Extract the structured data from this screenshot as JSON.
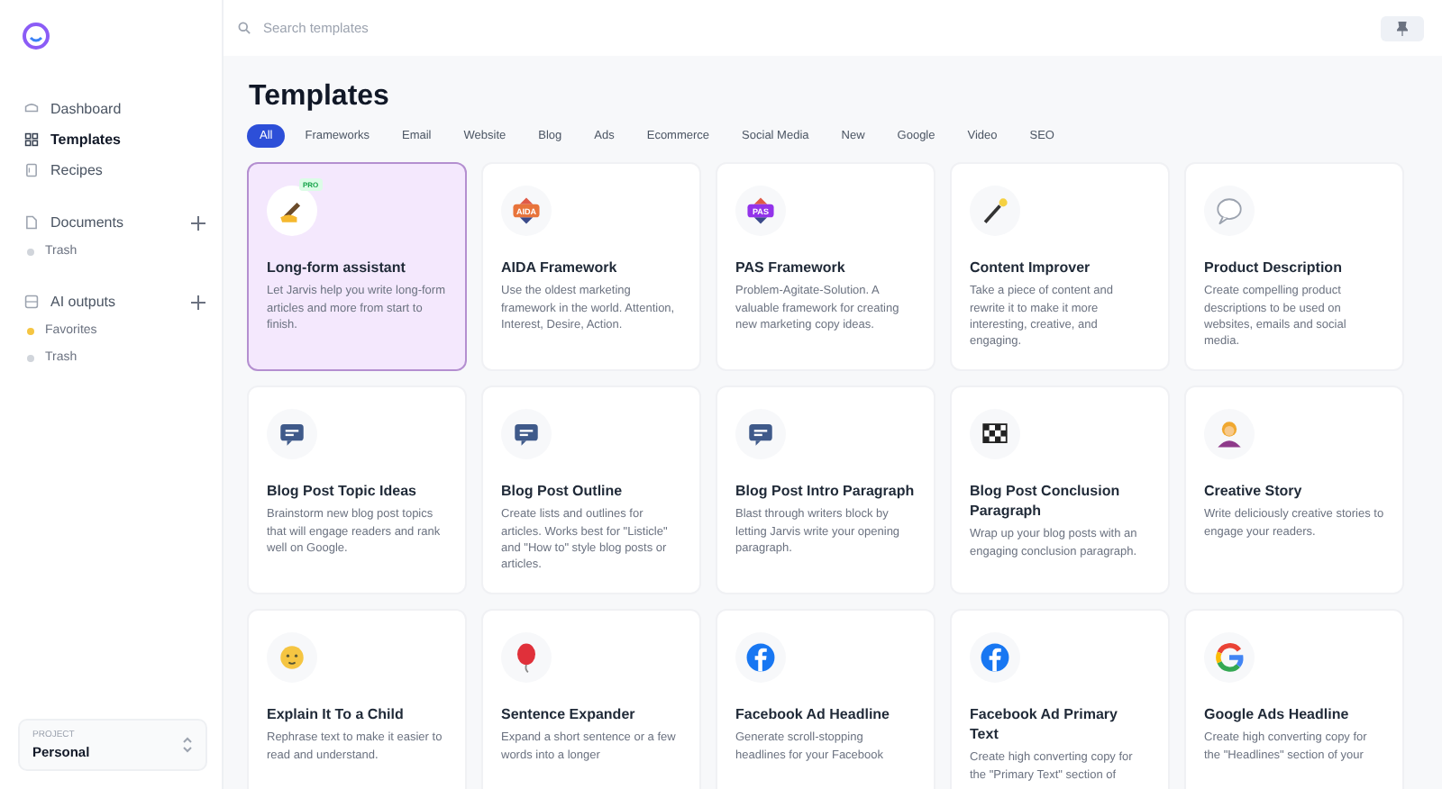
{
  "sidebar": {
    "items": [
      {
        "label": "Dashboard",
        "kind": "home",
        "selected": false
      },
      {
        "label": "Templates",
        "kind": "grid",
        "selected": true
      },
      {
        "label": "Recipes",
        "kind": "book",
        "selected": false
      }
    ],
    "sections": [
      {
        "label": "Documents",
        "kind": "doc",
        "entries": [
          {
            "label": "Trash",
            "color": "#d1d5db"
          }
        ]
      },
      {
        "label": "AI outputs",
        "kind": "tray",
        "entries": [
          {
            "label": "Favorites",
            "color": "#f5c542"
          },
          {
            "label": "Trash",
            "color": "#d1d5db"
          }
        ]
      }
    ],
    "project": {
      "label": "PROJECT",
      "value": "Personal"
    }
  },
  "search": {
    "placeholder": "Search templates"
  },
  "title": "Templates",
  "filters": [
    {
      "label": "All",
      "selected": true
    },
    {
      "label": "Frameworks",
      "selected": false
    },
    {
      "label": "Email",
      "selected": false
    },
    {
      "label": "Website",
      "selected": false
    },
    {
      "label": "Blog",
      "selected": false
    },
    {
      "label": "Ads",
      "selected": false
    },
    {
      "label": "Ecommerce",
      "selected": false
    },
    {
      "label": "Social Media",
      "selected": false
    },
    {
      "label": "New",
      "selected": false
    },
    {
      "label": "Google",
      "selected": false
    },
    {
      "label": "Video",
      "selected": false
    },
    {
      "label": "SEO",
      "selected": false
    }
  ],
  "cards": [
    {
      "title": "Long-form assistant",
      "description": "Let Jarvis help you write long-form articles and more from start to finish.",
      "kind": "pen",
      "badge": "PRO",
      "selected": true
    },
    {
      "title": "AIDA Framework",
      "description": "Use the oldest marketing framework in the world. Attention, Interest, Desire, Action.",
      "kind": "aida",
      "badge_text": "AIDA",
      "selected": false
    },
    {
      "title": "PAS Framework",
      "description": "Problem-Agitate-Solution. A valuable framework for creating new marketing copy ideas.",
      "kind": "pas",
      "badge_text": "PAS",
      "selected": false
    },
    {
      "title": "Content Improver",
      "description": "Take a piece of content and rewrite it to make it more interesting, creative, and engaging.",
      "kind": "wand",
      "selected": false
    },
    {
      "title": "Product Description",
      "description": "Create compelling product descriptions to be used on websites, emails and social media.",
      "kind": "bubble",
      "selected": false
    },
    {
      "title": "Blog Post Topic Ideas",
      "description": "Brainstorm new blog post topics that will engage readers and rank well on Google.",
      "kind": "chat",
      "selected": false
    },
    {
      "title": "Blog Post Outline",
      "description": "Create lists and outlines for articles. Works best for \"Listicle\" and \"How to\" style blog posts or articles.",
      "kind": "chat",
      "selected": false
    },
    {
      "title": "Blog Post Intro Paragraph",
      "description": "Blast through writers block by letting Jarvis write your opening paragraph.",
      "kind": "chat",
      "selected": false
    },
    {
      "title": "Blog Post Conclusion Paragraph",
      "description": "Wrap up your blog posts with an engaging conclusion paragraph.",
      "kind": "flag",
      "selected": false
    },
    {
      "title": "Creative Story",
      "description": "Write deliciously creative stories to engage your readers.",
      "kind": "person",
      "selected": false
    },
    {
      "title": "Explain It To a Child",
      "description": "Rephrase text to make it easier to read and understand.",
      "kind": "baby",
      "selected": false
    },
    {
      "title": "Sentence Expander",
      "description": "Expand a short sentence or a few words into a longer",
      "kind": "balloon",
      "selected": false
    },
    {
      "title": "Facebook Ad Headline",
      "description": "Generate scroll-stopping headlines for your Facebook",
      "kind": "facebook",
      "selected": false
    },
    {
      "title": "Facebook Ad Primary Text",
      "description": "Create high converting copy for the \"Primary Text\" section of",
      "kind": "facebook",
      "selected": false
    },
    {
      "title": "Google Ads Headline",
      "description": "Create high converting copy for the \"Headlines\" section of your",
      "kind": "google",
      "selected": false
    }
  ]
}
